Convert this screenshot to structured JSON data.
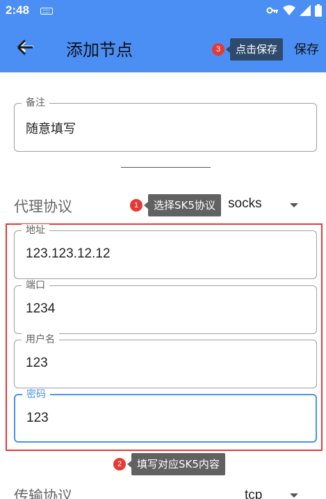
{
  "status_bar": {
    "time": "2:48",
    "icons": [
      "keyboard-icon",
      "vpn-key-icon",
      "wifi-icon",
      "cellular-icon",
      "battery-icon"
    ]
  },
  "app_bar": {
    "title": "添加节点",
    "save_label": "保存",
    "back_icon": "arrow-back-icon"
  },
  "form": {
    "remark": {
      "label": "备注",
      "value": "随意填写"
    },
    "protocol": {
      "label": "代理协议",
      "value": "socks"
    },
    "address": {
      "label": "地址",
      "value": "123.123.12.12"
    },
    "port": {
      "label": "端口",
      "value": "1234"
    },
    "username": {
      "label": "用户名",
      "value": "123"
    },
    "password": {
      "label": "密码",
      "value": "123"
    },
    "transport": {
      "label": "传输协议",
      "value": "tcp"
    }
  },
  "callouts": [
    {
      "number": "1",
      "text": "选择SK5协议"
    },
    {
      "number": "2",
      "text": "填写对应SK5内容"
    },
    {
      "number": "3",
      "text": "点击保存"
    }
  ],
  "colors": {
    "primary": "#4b8ff5",
    "callout_badge": "#e53935",
    "highlight_border": "#e53935"
  }
}
